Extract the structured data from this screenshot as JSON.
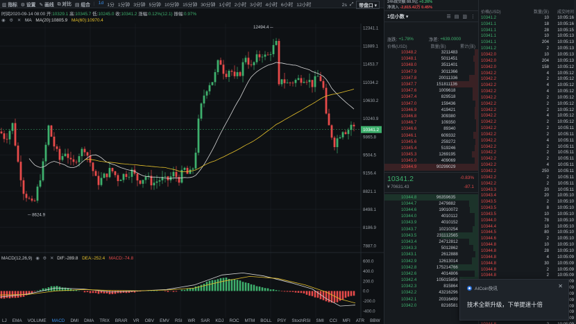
{
  "toolbar": {
    "left": [
      "指标",
      "设置",
      "画线",
      "对比",
      "组合"
    ],
    "intervals": [
      "1d",
      "1分",
      "1分钟",
      "3分钟",
      "5分钟",
      "10分钟",
      "15分钟",
      "30分钟",
      "1小时",
      "2小时",
      "3小时",
      "4小时",
      "6小时",
      "12小时"
    ],
    "active_interval": "1d",
    "right_1": "2s",
    "mode": "带盘口"
  },
  "ohlc": {
    "time": "时间2020-09-14 08:00",
    "open_l": "开:",
    "open": "10329.1",
    "high_l": "高:",
    "high": "10345.7",
    "low_l": "低:",
    "low": "10245.0",
    "close_l": "收:",
    "close": "10341.2",
    "chg_l": "涨幅:",
    "chg": "0.12%(12.1)",
    "amp_l": "振幅:",
    "amp": "0.97%"
  },
  "ma": {
    "name": "MA",
    "ma20": "MA(20):10805.9",
    "ma60": "MA(60):10970.4"
  },
  "macd": {
    "name": "MACD(12,26,9)",
    "dif": "DIF:-289.8",
    "dea": "DEA:-252.4",
    "val": "MACD:-74.8"
  },
  "bottom_tabs": [
    "LJ",
    "EMA",
    "VOLUME",
    "MACD",
    "DMI",
    "DMA",
    "TRIX",
    "BRAR",
    "VR",
    "OBV",
    "EMV",
    "RSI",
    "WR",
    "SAR",
    "KDJ",
    "ROC",
    "MTM",
    "BOLL",
    "PSY",
    "StochRSI",
    "SMI",
    "CCI",
    "MFI",
    "ATR",
    "BBW",
    "SKDJ",
    "BIAS"
  ],
  "active_tab": "MACD",
  "chart_data": {
    "type": "candlestick",
    "price_axis": [
      "12341.1",
      "11889.1",
      "11453.7",
      "11034.2",
      "10630.2",
      "10240.9",
      "9865.8",
      "9504.5",
      "9156.4",
      "8821.1",
      "8498.1",
      "8186.9",
      "7887.0"
    ],
    "macd_axis": [
      "600.0",
      "400.0",
      "200.0",
      "0.0",
      "-200.0",
      "-400.0"
    ],
    "high_label": "12494.4",
    "low_label": "8624.9",
    "last_label": "10341.2",
    "price_range": [
      7887.0,
      12494.4
    ]
  },
  "orderbook": {
    "top1_l": "24h成交额",
    "top1_v": "88.9亿",
    "top1_r": "+0.26%",
    "top2_l": "净流入",
    "top2_v": "-2,815.42万",
    "top2_r": "0.45%",
    "select": "1位小数",
    "change_l": "涨跌:",
    "change_v": "+1.78%",
    "flow_l": "净差:",
    "flow_v": "+639.0000",
    "columns": [
      "价格(USD)",
      "数量(张)",
      "累计(张)"
    ],
    "asks": [
      [
        "10348.2",
        "32",
        "11483",
        0.04
      ],
      [
        "10348.1",
        "50",
        "11451",
        0.05
      ],
      [
        "10348.0",
        "35",
        "11401",
        0.04
      ],
      [
        "10347.9",
        "30",
        "11366",
        0.04
      ],
      [
        "10347.8",
        "200",
        "11336",
        0.1
      ],
      [
        "10347.7",
        "1518",
        "11136",
        0.3
      ],
      [
        "10347.6",
        "100",
        "9618",
        0.06
      ],
      [
        "10347.4",
        "82",
        "9518",
        0.06
      ],
      [
        "10347.0",
        "15",
        "9436",
        0.03
      ],
      [
        "10346.9",
        "41",
        "9421",
        0.04
      ],
      [
        "10346.8",
        "30",
        "9380",
        0.04
      ],
      [
        "10346.7",
        "10",
        "9350",
        0.02
      ],
      [
        "10346.6",
        "8",
        "9340",
        0.02
      ],
      [
        "10346.1",
        "60",
        "9332",
        0.05
      ],
      [
        "10345.6",
        "25",
        "9272",
        0.03
      ],
      [
        "10345.4",
        "51",
        "9246",
        0.04
      ],
      [
        "10345.3",
        "126",
        "9195",
        0.07
      ],
      [
        "10345.0",
        "40",
        "9069",
        0.04
      ],
      [
        "10344.9",
        "9029",
        "9029",
        1.0
      ]
    ],
    "last_price": "10341.2",
    "last_pct": "-0.83%",
    "last_sub": "¥ 70631.43",
    "last_chg": "-87.1",
    "bids": [
      [
        "10344.8",
        "9635",
        "9635",
        1.0
      ],
      [
        "10344.7",
        "247",
        "9882",
        0.1
      ],
      [
        "10344.6",
        "190",
        "10072",
        0.09
      ],
      [
        "10344.0",
        "40",
        "10112",
        0.04
      ],
      [
        "10343.9",
        "40",
        "10152",
        0.04
      ],
      [
        "10343.7",
        "102",
        "10254",
        0.06
      ],
      [
        "10343.5",
        "2311",
        "12565",
        0.4
      ],
      [
        "10343.4",
        "247",
        "12812",
        0.1
      ],
      [
        "10343.3",
        "50",
        "12862",
        0.05
      ],
      [
        "10343.1",
        "26",
        "12888",
        0.03
      ],
      [
        "10342.9",
        "126",
        "13014",
        0.07
      ],
      [
        "10342.8",
        "1752",
        "14766",
        0.3
      ],
      [
        "10342.6",
        "40",
        "14806",
        0.04
      ],
      [
        "10342.4",
        "1050",
        "15856",
        0.2
      ],
      [
        "10342.3",
        "8",
        "15864",
        0.02
      ],
      [
        "10342.2",
        "432",
        "16296",
        0.1
      ],
      [
        "10342.1",
        "203",
        "16499",
        0.07
      ],
      [
        "10342.0",
        "82",
        "16581",
        0.06
      ]
    ]
  },
  "trades": {
    "columns": [
      "价格(USD)",
      "数量(张)",
      "成交时间"
    ],
    "rows": [
      [
        "10341.2",
        "10",
        "10:05:16",
        "g"
      ],
      [
        "10341.1",
        "18",
        "10:05:16",
        "g"
      ],
      [
        "10341.1",
        "28",
        "10:05:15",
        "g"
      ],
      [
        "10341.1",
        "10",
        "10:05:13",
        "g"
      ],
      [
        "10341.1",
        "204",
        "10:05:13",
        "g"
      ],
      [
        "10341.2",
        "2",
        "10:05:13",
        "g"
      ],
      [
        "10342.0",
        "10",
        "10:05:13",
        "r"
      ],
      [
        "10342.0",
        "204",
        "10:05:13",
        "r"
      ],
      [
        "10342.0",
        "158",
        "10:05:12",
        "r"
      ],
      [
        "10342.2",
        "4",
        "10:05:12",
        "r"
      ],
      [
        "10342.2",
        "2",
        "10:05:12",
        "r"
      ],
      [
        "10342.2",
        "4",
        "10:05:12",
        "r"
      ],
      [
        "10342.2",
        "4",
        "10:05:12",
        "r"
      ],
      [
        "10342.2",
        "2",
        "10:05:12",
        "r"
      ],
      [
        "10342.2",
        "2",
        "10:05:12",
        "r"
      ],
      [
        "10342.2",
        "2",
        "10:05:12",
        "r"
      ],
      [
        "10342.2",
        "4",
        "10:05:12",
        "r"
      ],
      [
        "10342.2",
        "2",
        "10:05:12",
        "r"
      ],
      [
        "10342.2",
        "2",
        "10:05:11",
        "r"
      ],
      [
        "10342.2",
        "2",
        "10:05:11",
        "r"
      ],
      [
        "10342.2",
        "4",
        "10:05:11",
        "r"
      ],
      [
        "10342.2",
        "2",
        "10:05:11",
        "r"
      ],
      [
        "10342.2",
        "2",
        "10:05:11",
        "r"
      ],
      [
        "10342.2",
        "2",
        "10:05:11",
        "r"
      ],
      [
        "10342.2",
        "4",
        "10:05:11",
        "r"
      ],
      [
        "10342.2",
        "250",
        "10:05:11",
        "r"
      ],
      [
        "10342.2",
        "2",
        "10:05:11",
        "r"
      ],
      [
        "10342.2",
        "2",
        "10:05:11",
        "r"
      ],
      [
        "10343.3",
        "20",
        "10:05:11",
        "r"
      ],
      [
        "10343.4",
        "20",
        "10:05:10",
        "r"
      ],
      [
        "10343.5",
        "2",
        "10:05:10",
        "r"
      ],
      [
        "10343.5",
        "8",
        "10:05:10",
        "r"
      ],
      [
        "10343.5",
        "10",
        "10:05:10",
        "r"
      ],
      [
        "10344.0",
        "78",
        "10:05:10",
        "r"
      ],
      [
        "10344.4",
        "10",
        "10:05:10",
        "r"
      ],
      [
        "10344.5",
        "80",
        "10:05:10",
        "r"
      ],
      [
        "10344.6",
        "2",
        "10:05:10",
        "r"
      ],
      [
        "10344.8",
        "10",
        "10:05:10",
        "r"
      ],
      [
        "10344.8",
        "28",
        "10:05:10",
        "r"
      ],
      [
        "10344.8",
        "4",
        "10:05:09",
        "r"
      ],
      [
        "10344.8",
        "30",
        "10:05:09",
        "r"
      ],
      [
        "10344.8",
        "2",
        "10:05:09",
        "r"
      ],
      [
        "10344.8",
        "2",
        "10:05:09",
        "r"
      ],
      [
        "10344.8",
        "10",
        "10:05:09",
        "r"
      ],
      [
        "10344.8",
        "2",
        "10:05:09",
        "r"
      ],
      [
        "10344.8",
        "2",
        "10:05:09",
        "r"
      ],
      [
        "10344.8",
        "2",
        "10:05:09",
        "r"
      ],
      [
        "10344.8",
        "2",
        "10:05:09",
        "r"
      ],
      [
        "10344.8",
        "2",
        "10:05:09",
        "r"
      ],
      [
        "10344.8",
        "2",
        "10:05:09",
        "r"
      ],
      [
        "10344.8",
        "2",
        "10:05:09",
        "r"
      ]
    ]
  },
  "toast": {
    "title": "AICoin快讯",
    "message": "技术全新升级，下单提速十倍",
    "close": "✕"
  },
  "colors": {
    "up": "#3eb06d",
    "down": "#e74a4a",
    "accent": "#3a8ee6",
    "ma20": "#d8d8d8",
    "ma60": "#e6c12b"
  }
}
